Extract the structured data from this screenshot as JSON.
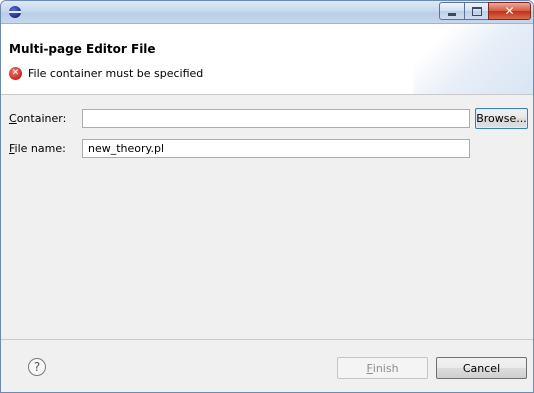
{
  "window": {
    "title": ""
  },
  "header": {
    "title": "Multi-page Editor File",
    "message": "File container must be specified",
    "message_icon": "error-icon"
  },
  "form": {
    "container_label_accel": "C",
    "container_label_rest": "ontainer:",
    "container_value": "",
    "browse_label": "Browse...",
    "file_label_accel": "F",
    "file_label_rest": "ile name:",
    "file_value": "new_theory.pl"
  },
  "footer": {
    "help_glyph": "?",
    "finish_accel": "F",
    "finish_rest": "inish",
    "cancel_label": "Cancel"
  },
  "colors": {
    "error": "#c8281e",
    "focus_border": "#3c7fb1",
    "titlebar": "#c7d9ee"
  }
}
